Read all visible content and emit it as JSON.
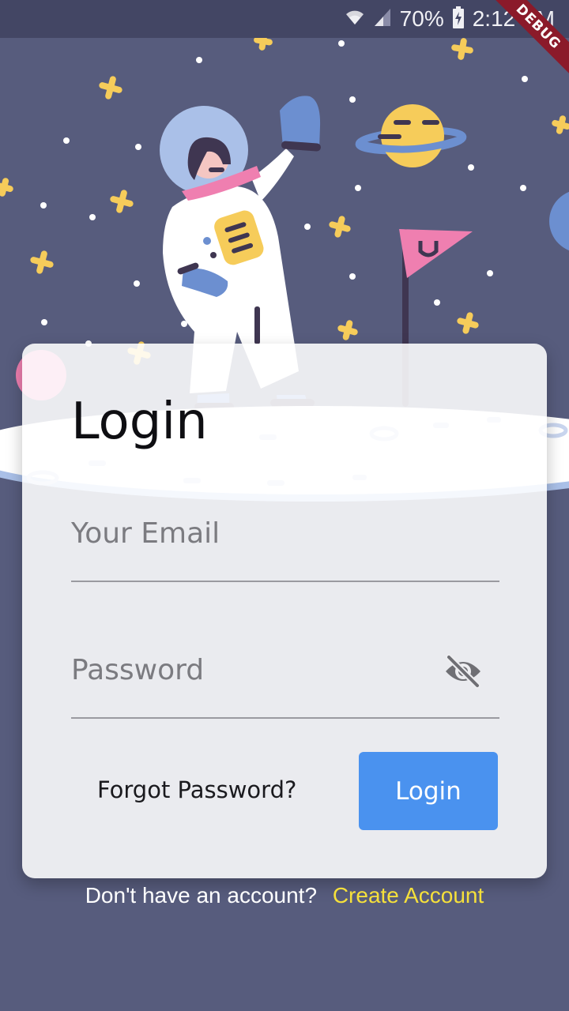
{
  "status_bar": {
    "battery": "70%",
    "time": "2:12 PM",
    "icons": [
      "wifi-icon",
      "cellular-signal-icon",
      "battery-charging-icon"
    ]
  },
  "debug_banner": "DEBUG",
  "illustration": {
    "description": "astronaut-on-moon",
    "colors": {
      "background": "#575c7d",
      "star": "#f6cc5a",
      "helmet": "#aac0e8",
      "flag": "#ef7fb0",
      "planet": "#f6cc5a"
    }
  },
  "login_card": {
    "title": "Login",
    "email_placeholder": "Your Email",
    "password_placeholder": "Password",
    "visibility_icon": "visibility-off-icon",
    "forgot_password": "Forgot Password?",
    "login_button": "Login"
  },
  "signup": {
    "prompt": "Don't have an account?",
    "link": "Create Account"
  },
  "colors": {
    "accent": "#4a92ef",
    "link": "#f5e03b",
    "status_bar": "#434664"
  }
}
